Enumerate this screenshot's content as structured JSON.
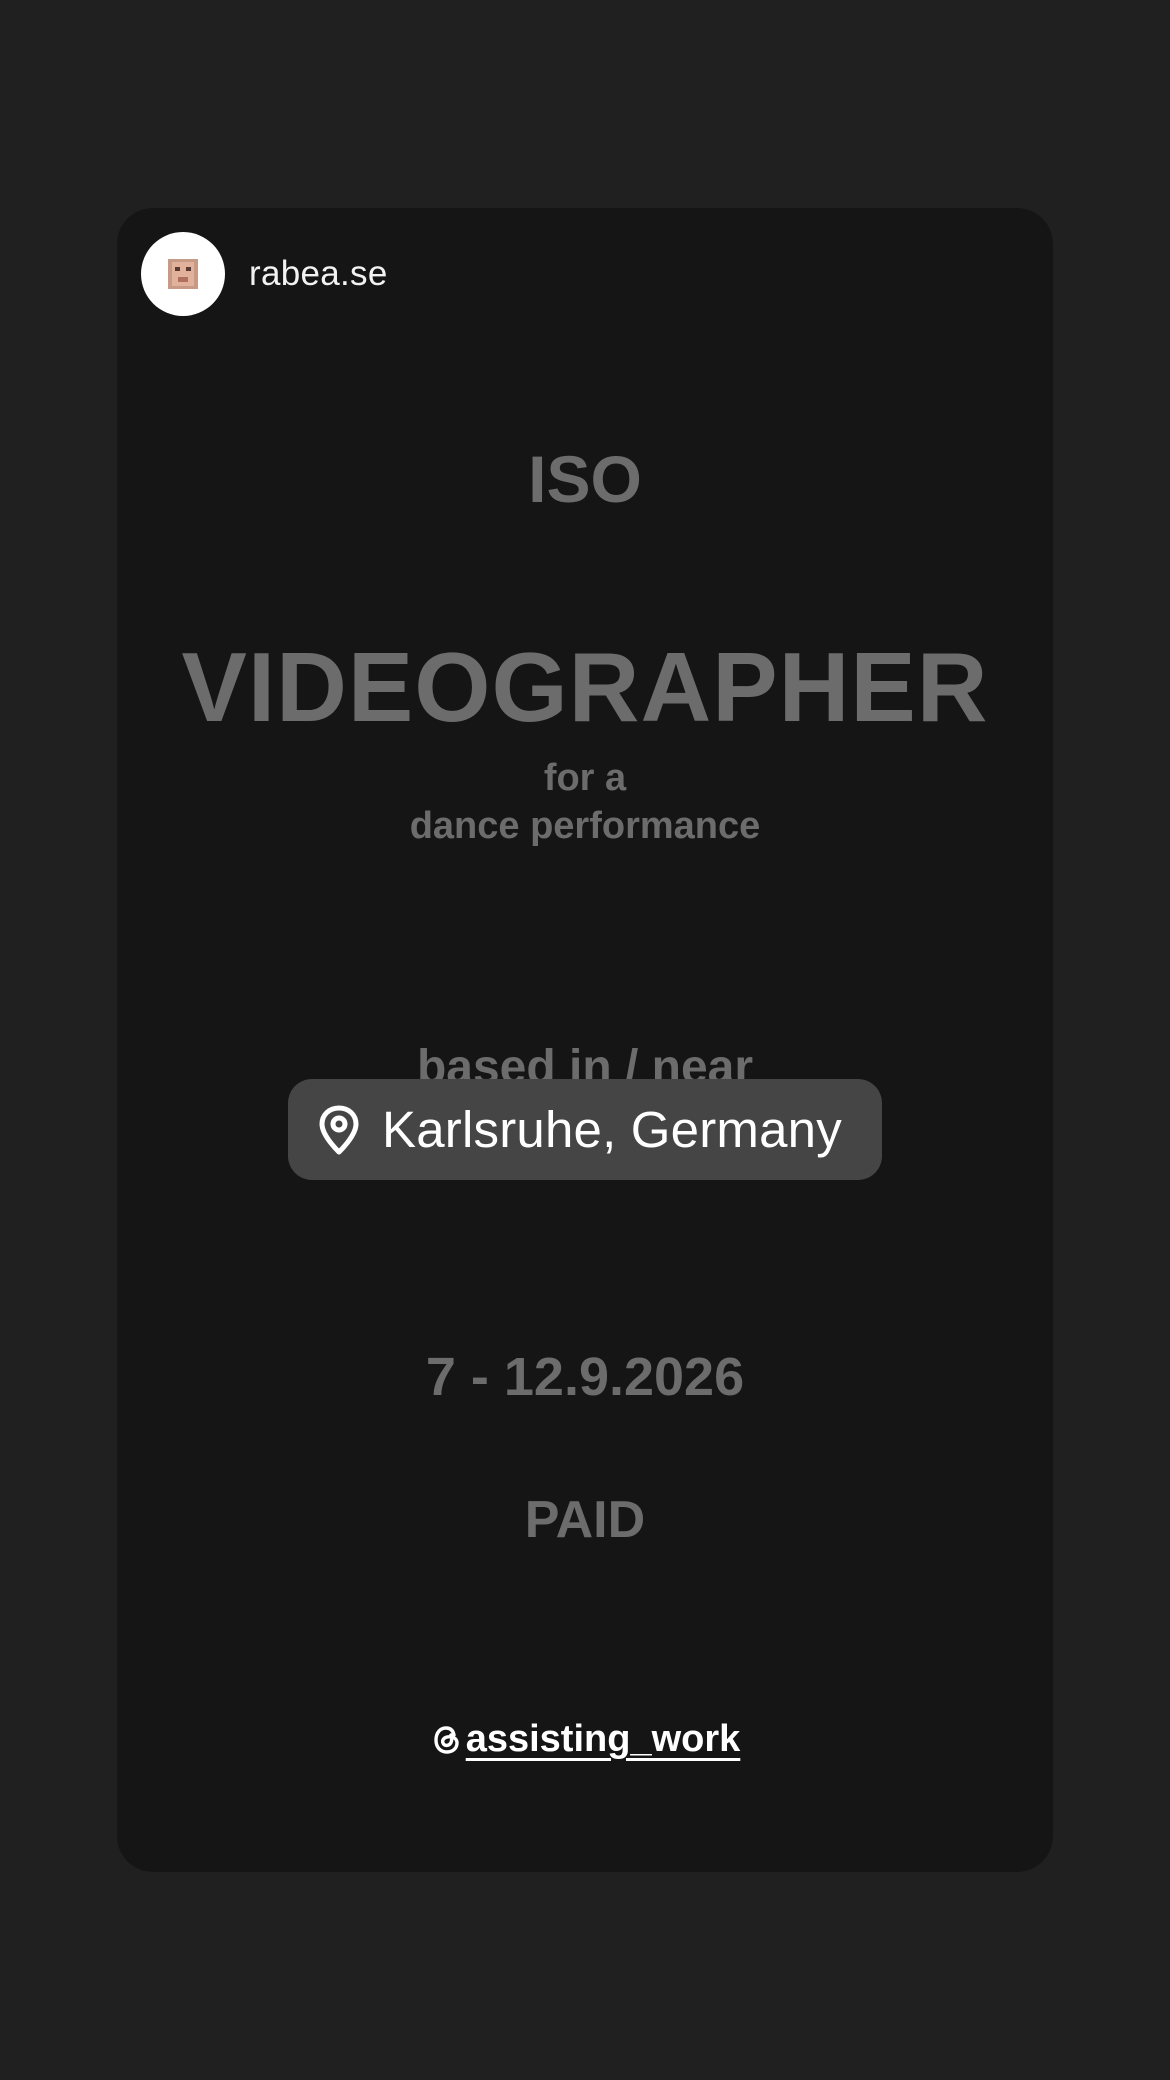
{
  "story": {
    "username": "rabea.se",
    "avatar_icon": "profile-photo",
    "headline": "ISO",
    "title": "VIDEOGRAPHER",
    "subtitle_line1": "for a",
    "subtitle_line2": "dance performance",
    "based_label": "based in / near",
    "location": "Karlsruhe, Germany",
    "dates": "7 - 12.9.2026",
    "payment": "PAID",
    "mention": "assisting_work",
    "mention_icon": "threads-icon"
  },
  "colors": {
    "background": "#202020",
    "card": "#151515",
    "muted_text": "#6c6c6c",
    "sticker": "#454545",
    "white": "#ffffff"
  }
}
